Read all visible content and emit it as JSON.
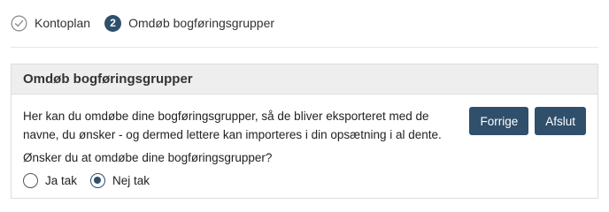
{
  "stepper": {
    "steps": [
      {
        "label": "Kontoplan",
        "state": "done",
        "icon": "check-circle-icon"
      },
      {
        "number": "2",
        "label": "Omdøb bogføringsgrupper",
        "state": "active"
      }
    ]
  },
  "panel": {
    "title": "Omdøb bogføringsgrupper",
    "description": "Her kan du omdøbe dine bogføringsgrupper, så de bliver eksporteret med de navne, du ønsker - og dermed lettere kan importeres i din opsætning i al dente.",
    "question": "Ønsker du at omdøbe dine bogføringsgrupper?",
    "options": [
      {
        "label": "Ja tak",
        "checked": false
      },
      {
        "label": "Nej tak",
        "checked": true
      }
    ],
    "buttons": {
      "back": "Forrige",
      "finish": "Afslut"
    }
  },
  "colors": {
    "primary": "#2f4f6b",
    "header_bg": "#eeeeee",
    "border": "#dcdcdc"
  }
}
